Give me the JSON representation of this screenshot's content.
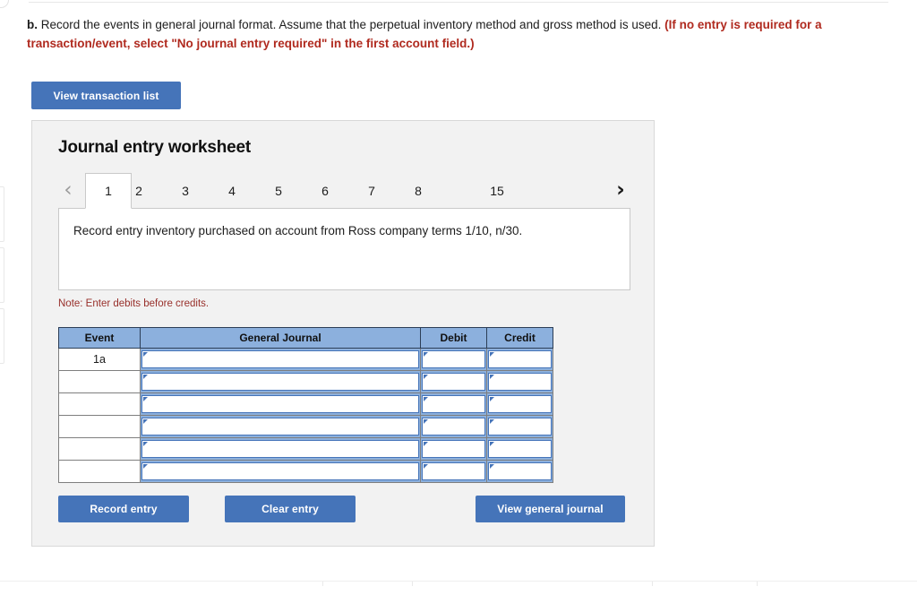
{
  "prompt": {
    "lead": "b.",
    "body": " Record the events in general journal format. Assume that the perpetual inventory method and gross method is used. ",
    "required_note": "(If no entry is required for a transaction/event, select \"No journal entry required\" in the first account field.)"
  },
  "toolbar": {
    "view_transaction_list": "View transaction list"
  },
  "panel": {
    "title": "Journal entry worksheet",
    "nav": {
      "prev_icon": "‹",
      "next_icon": "›"
    },
    "tabs": [
      {
        "label": "1",
        "active": true
      },
      {
        "label": "2",
        "active": false
      },
      {
        "label": "3",
        "active": false
      },
      {
        "label": "4",
        "active": false
      },
      {
        "label": "5",
        "active": false
      },
      {
        "label": "6",
        "active": false
      },
      {
        "label": "7",
        "active": false
      },
      {
        "label": "8",
        "active": false
      },
      {
        "label": "15",
        "active": false
      }
    ],
    "instruction": "Record entry inventory purchased on account from Ross company terms 1/10, n/30.",
    "note": "Note: Enter debits before credits."
  },
  "journal": {
    "columns": [
      "Event",
      "General Journal",
      "Debit",
      "Credit"
    ],
    "rows": [
      {
        "event": "1a",
        "general_journal": "",
        "debit": "",
        "credit": ""
      },
      {
        "event": "",
        "general_journal": "",
        "debit": "",
        "credit": ""
      },
      {
        "event": "",
        "general_journal": "",
        "debit": "",
        "credit": ""
      },
      {
        "event": "",
        "general_journal": "",
        "debit": "",
        "credit": ""
      },
      {
        "event": "",
        "general_journal": "",
        "debit": "",
        "credit": ""
      },
      {
        "event": "",
        "general_journal": "",
        "debit": "",
        "credit": ""
      }
    ]
  },
  "actions": {
    "record_entry": "Record entry",
    "clear_entry": "Clear entry",
    "view_general_journal": "View general journal"
  },
  "colors": {
    "button_blue": "#4574b9",
    "table_header_blue": "#8cb0dd",
    "required_red": "#b02a1f",
    "note_red": "#98302b",
    "panel_bg": "#f2f2f2"
  }
}
